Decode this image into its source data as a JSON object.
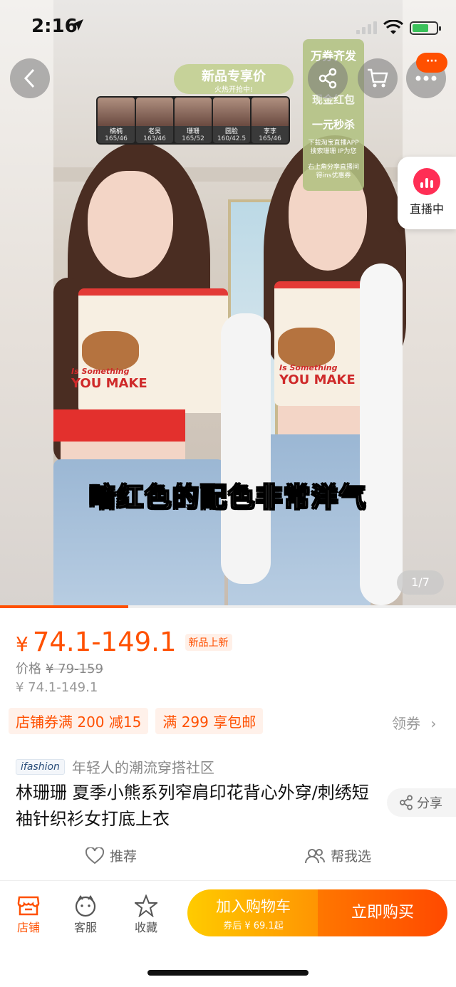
{
  "status": {
    "time": "2:16"
  },
  "hero": {
    "promo_title": "新品专享价",
    "promo_sub": "火热开抢中!",
    "caption": "暗红色的配色非常洋气",
    "shirt_text_small": "Is Something",
    "shirt_text": "YOU MAKE",
    "models": [
      {
        "name": "楠楠",
        "size": "165/46"
      },
      {
        "name": "老吴",
        "size": "163/46"
      },
      {
        "name": "珊珊",
        "size": "165/52"
      },
      {
        "name": "圆脸",
        "size": "160/42.5"
      },
      {
        "name": "李李",
        "size": "165/46"
      }
    ],
    "coupon_card": {
      "line1": "万券齐发",
      "line2": "现金红包",
      "line3": "一元秒杀",
      "line4": "下载淘宝直播APP 搜索珊珊 IP为您",
      "line5": "右上角分享直播间 得ins优惠券"
    },
    "more_badge": "···",
    "live_label": "直播中",
    "pager": "1/7"
  },
  "product": {
    "currency": "¥",
    "price": "74.1-149.1",
    "new_tag": "新品上新",
    "orig_label": "价格",
    "orig_price": "¥ 79-159",
    "range": "¥ 74.1-149.1",
    "coupons": [
      "店铺券满 200 减15",
      "满 299 享包邮"
    ],
    "get_coupon": "领券",
    "brand_logo": "ifashion",
    "brand_slogan": "年轻人的潮流穿搭社区",
    "title": "林珊珊 夏季小熊系列窄肩印花背心外穿/刺绣短袖针织衫女打底上衣",
    "share": "分享",
    "recommend": "推荐",
    "help_choose": "帮我选"
  },
  "bottom": {
    "store": "店铺",
    "service": "客服",
    "favorite": "收藏",
    "add_cart": "加入购物车",
    "add_cart_sub": "券后 ¥ 69.1起",
    "buy_now": "立即购买"
  },
  "colors": {
    "accent": "#ff5000",
    "cart": "#ffb300",
    "live": "#ff2e55"
  }
}
